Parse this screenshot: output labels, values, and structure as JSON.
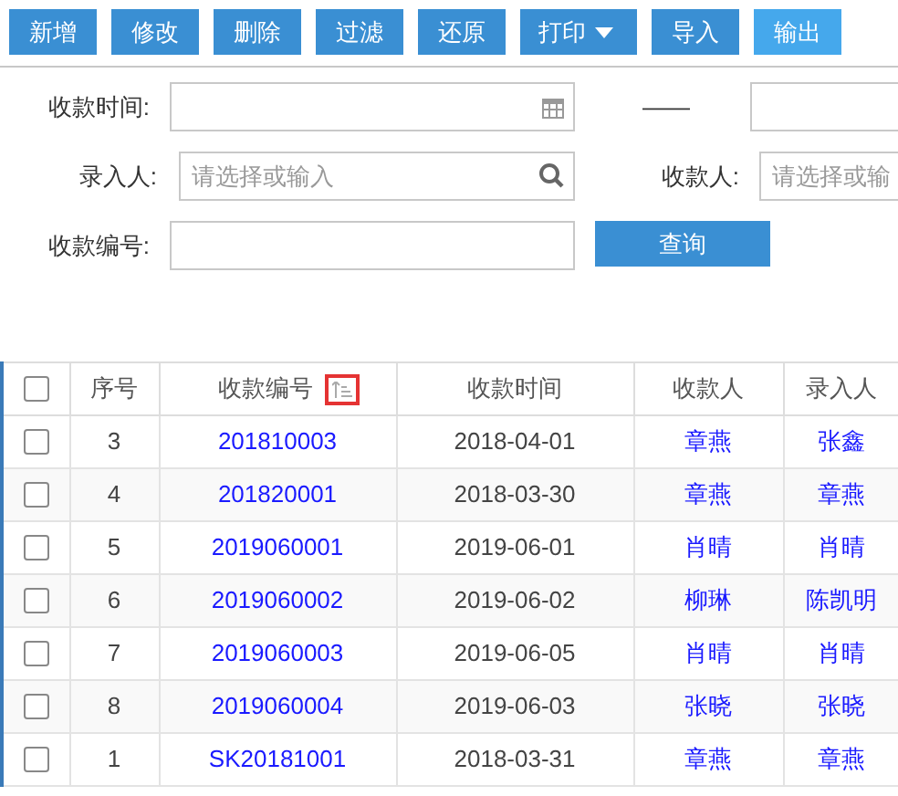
{
  "toolbar": [
    {
      "label": "新增",
      "kind": "plain",
      "hovered": false
    },
    {
      "label": "修改",
      "kind": "plain",
      "hovered": false
    },
    {
      "label": "删除",
      "kind": "plain",
      "hovered": false
    },
    {
      "label": "过滤",
      "kind": "plain",
      "hovered": false
    },
    {
      "label": "还原",
      "kind": "plain",
      "hovered": false
    },
    {
      "label": "打印",
      "kind": "dropdown",
      "hovered": false
    },
    {
      "label": "导入",
      "kind": "plain",
      "hovered": false
    },
    {
      "label": "输出",
      "kind": "plain",
      "hovered": true
    }
  ],
  "filters": {
    "date_label": "收款时间:",
    "date_separator": "——",
    "entered_by_label": "录入人:",
    "entered_by_placeholder": "请选择或输入",
    "payee_label": "收款人:",
    "payee_placeholder": "请选择或输",
    "number_label": "收款编号:",
    "query_button": "查询"
  },
  "table": {
    "header_checked": false,
    "columns": [
      "序号",
      "收款编号",
      "收款时间",
      "收款人",
      "录入人"
    ],
    "rows": [
      {
        "checked": false,
        "cells": [
          "3",
          "201810003",
          "2018-04-01",
          "章燕",
          "张鑫"
        ]
      },
      {
        "checked": false,
        "cells": [
          "4",
          "201820001",
          "2018-03-30",
          "章燕",
          "章燕"
        ]
      },
      {
        "checked": false,
        "cells": [
          "5",
          "2019060001",
          "2019-06-01",
          "肖晴",
          "肖晴"
        ]
      },
      {
        "checked": false,
        "cells": [
          "6",
          "2019060002",
          "2019-06-02",
          "柳琳",
          "陈凯明"
        ]
      },
      {
        "checked": false,
        "cells": [
          "7",
          "2019060003",
          "2019-06-05",
          "肖晴",
          "肖晴"
        ]
      },
      {
        "checked": false,
        "cells": [
          "8",
          "2019060004",
          "2019-06-03",
          "张晓",
          "张晓"
        ]
      },
      {
        "checked": false,
        "cells": [
          "1",
          "SK20181001",
          "2018-03-31",
          "章燕",
          "章燕"
        ]
      }
    ]
  }
}
